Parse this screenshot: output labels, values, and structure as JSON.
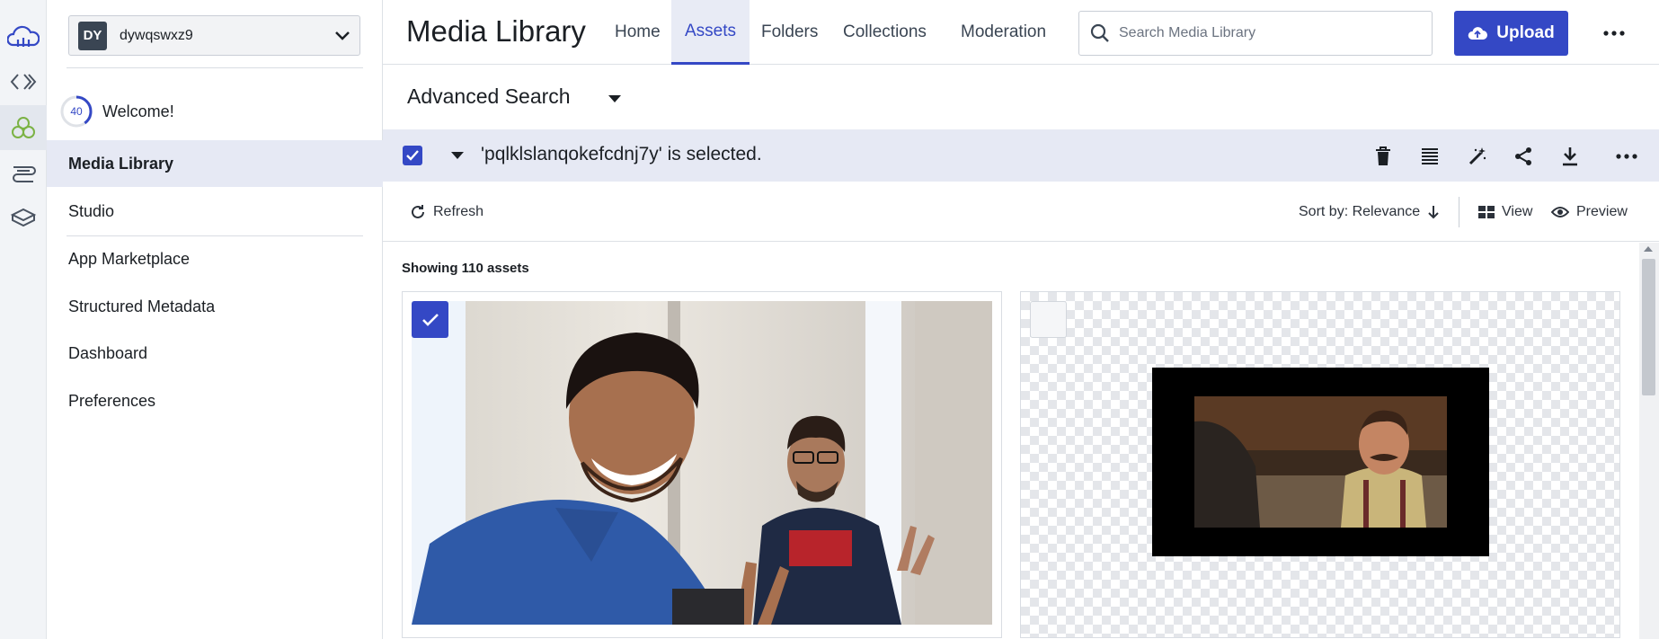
{
  "rail": {
    "icons": [
      "cloud-logo-icon",
      "code-icon",
      "assets-icon",
      "stack-icon",
      "planet-icon"
    ]
  },
  "sidebar": {
    "environment": {
      "avatar": "DY",
      "name": "dywqswxz9"
    },
    "welcome": {
      "progress": "40",
      "label": "Welcome!"
    },
    "items": [
      {
        "label": "Media Library",
        "active": true
      },
      {
        "label": "Studio",
        "active": false
      },
      {
        "label": "App Marketplace",
        "active": false
      },
      {
        "label": "Structured Metadata",
        "active": false
      },
      {
        "label": "Dashboard",
        "active": false
      },
      {
        "label": "Preferences",
        "active": false
      }
    ]
  },
  "header": {
    "title": "Media Library",
    "tabs": [
      {
        "label": "Home",
        "active": false
      },
      {
        "label": "Assets",
        "active": true
      },
      {
        "label": "Folders",
        "active": false
      },
      {
        "label": "Collections",
        "active": false
      },
      {
        "label": "Moderation",
        "active": false
      }
    ],
    "search_placeholder": "Search Media Library",
    "upload_label": "Upload"
  },
  "advanced_search": {
    "label": "Advanced Search"
  },
  "selection": {
    "text": "'pqlklslanqokefcdnj7y' is selected.",
    "actions": [
      "delete-icon",
      "list-icon",
      "magic-wand-icon",
      "share-icon",
      "download-icon",
      "more-icon"
    ]
  },
  "toolbar": {
    "refresh_label": "Refresh",
    "sort_label": "Sort by: Relevance",
    "view_label": "View",
    "preview_label": "Preview"
  },
  "content": {
    "count_label": "Showing 110 assets",
    "assets": [
      {
        "selected": true,
        "kind": "selfie-photo"
      },
      {
        "selected": false,
        "kind": "movie-still"
      }
    ]
  },
  "colors": {
    "accent": "#3448c5",
    "selection_bg": "#e6e9f4",
    "rail_bg": "#f2f4f7"
  }
}
